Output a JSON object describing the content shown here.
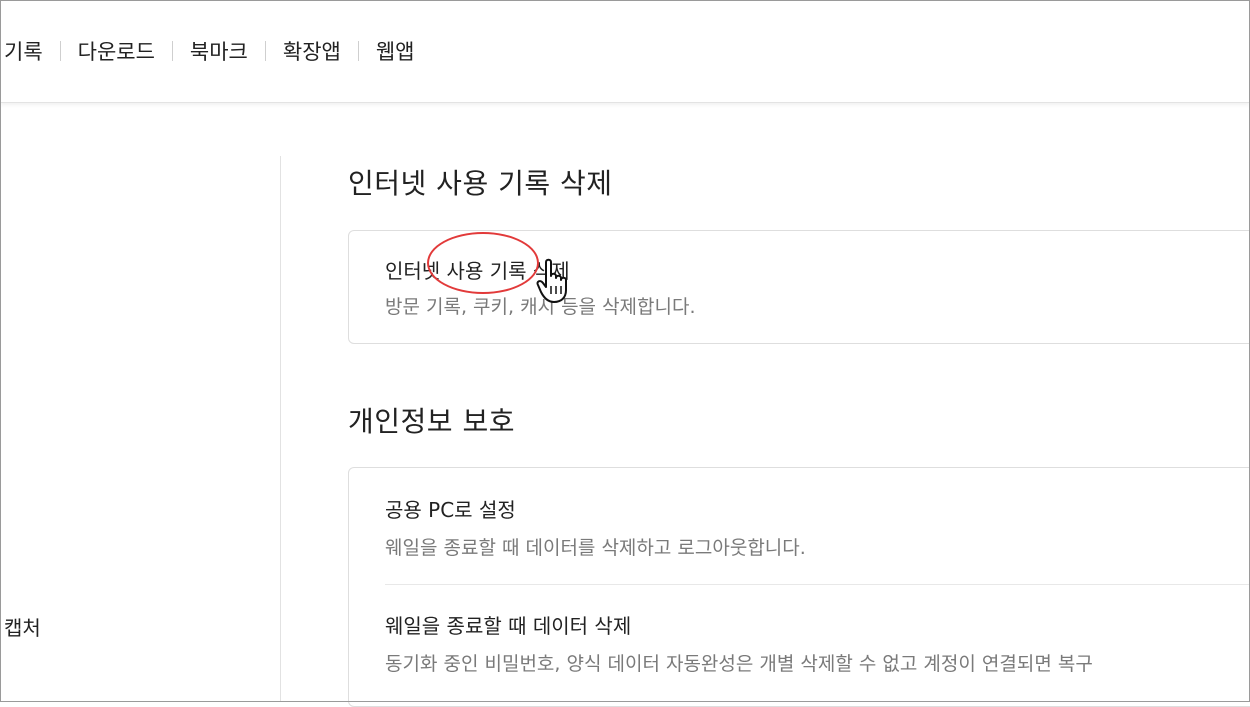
{
  "nav": {
    "items": [
      {
        "label": "기록"
      },
      {
        "label": "다운로드"
      },
      {
        "label": "북마크"
      },
      {
        "label": "확장앱"
      },
      {
        "label": "웹앱"
      }
    ]
  },
  "sidebar": {
    "items": [
      {
        "label": "캡처"
      }
    ]
  },
  "sections": {
    "history": {
      "title": "인터넷 사용 기록 삭제",
      "rows": [
        {
          "title": "인터넷 사용 기록 삭제",
          "desc": "방문 기록, 쿠키, 캐시 등을 삭제합니다."
        }
      ]
    },
    "privacy": {
      "title": "개인정보 보호",
      "rows": [
        {
          "title": "공용 PC로 설정",
          "desc": "웨일을 종료할 때 데이터를 삭제하고 로그아웃합니다."
        },
        {
          "title": "웨일을 종료할 때 데이터 삭제",
          "desc": "동기화 중인 비밀번호, 양식 데이터 자동완성은 개별 삭제할 수 없고 계정이 연결되면 복구"
        }
      ]
    }
  },
  "annotation": {
    "highlight_color": "#e23a3a",
    "cursor_icon": "hand-pointer-icon"
  }
}
